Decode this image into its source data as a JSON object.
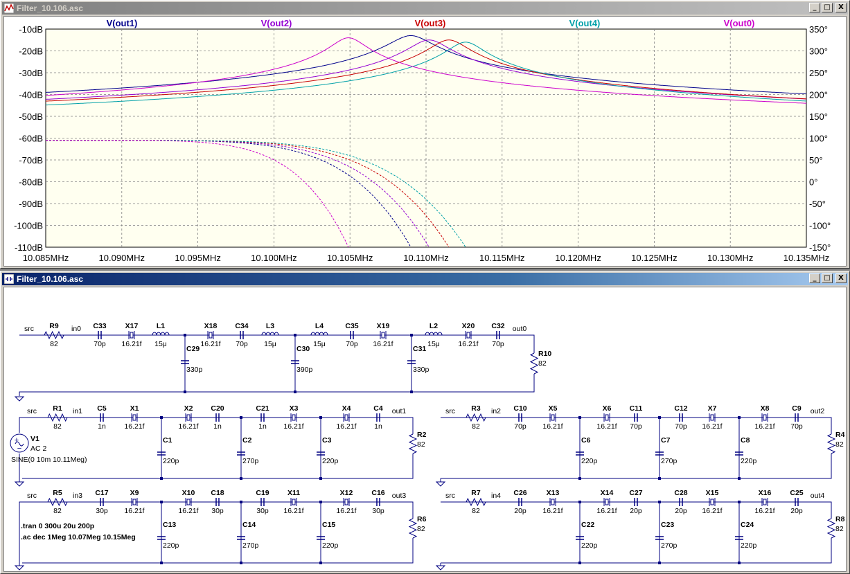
{
  "plot_window": {
    "title": "Filter_10.106.asc",
    "buttons": {
      "minimize": "_",
      "maximize": "□",
      "close": "X"
    }
  },
  "schematic_window": {
    "title": "Filter_10.106.asc",
    "buttons": {
      "minimize": "_",
      "maximize": "□",
      "close": "X"
    }
  },
  "colors": {
    "plot_bg": "#fffff0",
    "out1": "#00008b",
    "out2": "#9400d3",
    "out3": "#c80000",
    "out4": "#00a0a8",
    "out0": "#cc00cc",
    "wire": "#000080"
  },
  "chart_data": {
    "type": "line",
    "x_unit": "MHz",
    "xlim": [
      10.085,
      10.135
    ],
    "x_tick_labels": [
      "10.085MHz",
      "10.090MHz",
      "10.095MHz",
      "10.100MHz",
      "10.105MHz",
      "10.110MHz",
      "10.115MHz",
      "10.120MHz",
      "10.125MHz",
      "10.130MHz",
      "10.135MHz"
    ],
    "ylim_left": [
      -110,
      -10
    ],
    "y_left_tick_labels": [
      "-10dB",
      "-20dB",
      "-30dB",
      "-40dB",
      "-50dB",
      "-60dB",
      "-70dB",
      "-80dB",
      "-90dB",
      "-100dB",
      "-110dB"
    ],
    "ylim_right": [
      -150,
      350
    ],
    "y_right_tick_labels": [
      "350°",
      "300°",
      "250°",
      "200°",
      "150°",
      "100°",
      "50°",
      "0°",
      "-50°",
      "-100°",
      "-150°"
    ],
    "grid": true,
    "series": [
      {
        "name": "V(out1)",
        "color_key": "out1",
        "peak_mhz": 10.109,
        "peak_db": -13,
        "bandwidth_mhz": 0.0024
      },
      {
        "name": "V(out2)",
        "color_key": "out2",
        "peak_mhz": 10.1102,
        "peak_db": -15,
        "bandwidth_mhz": 0.0022
      },
      {
        "name": "V(out3)",
        "color_key": "out3",
        "peak_mhz": 10.1115,
        "peak_db": -15,
        "bandwidth_mhz": 0.0021
      },
      {
        "name": "V(out4)",
        "color_key": "out4",
        "peak_mhz": 10.1126,
        "peak_db": -16,
        "bandwidth_mhz": 0.002
      },
      {
        "name": "V(out0)",
        "color_key": "out0",
        "peak_mhz": 10.1049,
        "peak_db": -14,
        "bandwidth_mhz": 0.0019
      }
    ]
  },
  "schematic": {
    "netlabels": [
      "src",
      "in0",
      "out0",
      "src",
      "in1",
      "out1",
      "src",
      "in2",
      "out2",
      "src",
      "in3",
      "out3",
      "src",
      "in4",
      "out4"
    ],
    "filter0": {
      "R9": [
        "R9",
        "82"
      ],
      "C33": [
        "C33",
        "70p"
      ],
      "X17": [
        "X17",
        "16.21f"
      ],
      "L1": [
        "L1",
        "15μ"
      ],
      "X18": [
        "X18",
        "16.21f"
      ],
      "C34": [
        "C34",
        "70p"
      ],
      "L3": [
        "L3",
        "15μ"
      ],
      "L4": [
        "L4",
        "15μ"
      ],
      "C35": [
        "C35",
        "70p"
      ],
      "X19": [
        "X19",
        "16.21f"
      ],
      "L2": [
        "L2",
        "15μ"
      ],
      "X20": [
        "X20",
        "16.21f"
      ],
      "C32": [
        "C32",
        "70p"
      ],
      "C29": [
        "C29",
        "330p"
      ],
      "C30": [
        "C30",
        "390p"
      ],
      "C31": [
        "C31",
        "330p"
      ],
      "R10": [
        "R10",
        "82"
      ]
    },
    "filter1": {
      "R1": [
        "R1",
        "82"
      ],
      "C5": [
        "C5",
        "1n"
      ],
      "X1": [
        "X1",
        "16.21f"
      ],
      "X2": [
        "X2",
        "16.21f"
      ],
      "C20": [
        "C20",
        "1n"
      ],
      "C21": [
        "C21",
        "1n"
      ],
      "X3": [
        "X3",
        "16.21f"
      ],
      "X4": [
        "X4",
        "16.21f"
      ],
      "C4": [
        "C4",
        "1n"
      ],
      "C1": [
        "C1",
        "220p"
      ],
      "C2": [
        "C2",
        "270p"
      ],
      "C3": [
        "C3",
        "220p"
      ],
      "R2": [
        "R2",
        "82"
      ]
    },
    "filter2": {
      "R3": [
        "R3",
        "82"
      ],
      "C10": [
        "C10",
        "70p"
      ],
      "X5": [
        "X5",
        "16.21f"
      ],
      "X6": [
        "X6",
        "16.21f"
      ],
      "C11": [
        "C11",
        "70p"
      ],
      "C12": [
        "C12",
        "70p"
      ],
      "X7": [
        "X7",
        "16.21f"
      ],
      "X8": [
        "X8",
        "16.21f"
      ],
      "C9": [
        "C9",
        "70p"
      ],
      "C6": [
        "C6",
        "220p"
      ],
      "C7": [
        "C7",
        "270p"
      ],
      "C8": [
        "C8",
        "220p"
      ],
      "R4": [
        "R4",
        "82"
      ]
    },
    "filter3": {
      "R5": [
        "R5",
        "82"
      ],
      "C17": [
        "C17",
        "30p"
      ],
      "X9": [
        "X9",
        "16.21f"
      ],
      "X10": [
        "X10",
        "16.21f"
      ],
      "C18": [
        "C18",
        "30p"
      ],
      "C19": [
        "C19",
        "30p"
      ],
      "X11": [
        "X11",
        "16.21f"
      ],
      "X12": [
        "X12",
        "16.21f"
      ],
      "C16": [
        "C16",
        "30p"
      ],
      "C13": [
        "C13",
        "220p"
      ],
      "C14": [
        "C14",
        "270p"
      ],
      "C15": [
        "C15",
        "220p"
      ],
      "R6": [
        "R6",
        "82"
      ]
    },
    "filter4": {
      "R7": [
        "R7",
        "82"
      ],
      "C26": [
        "C26",
        "20p"
      ],
      "X13": [
        "X13",
        "16.21f"
      ],
      "X14": [
        "X14",
        "16.21f"
      ],
      "C27": [
        "C27",
        "20p"
      ],
      "C28": [
        "C28",
        "20p"
      ],
      "X15": [
        "X15",
        "16.21f"
      ],
      "X16": [
        "X16",
        "16.21f"
      ],
      "C25": [
        "C25",
        "20p"
      ],
      "C22": [
        "C22",
        "220p"
      ],
      "C23": [
        "C23",
        "270p"
      ],
      "C24": [
        "C24",
        "220p"
      ],
      "R8": [
        "R8",
        "82"
      ]
    },
    "source": {
      "name": "V1",
      "ac": "AC 2",
      "sine": "SINE(0 10m 10.11Meg)"
    },
    "directives": [
      ".tran 0 300u 20u 200p",
      ".ac dec 1Meg 10.07Meg 10.15Meg"
    ]
  }
}
